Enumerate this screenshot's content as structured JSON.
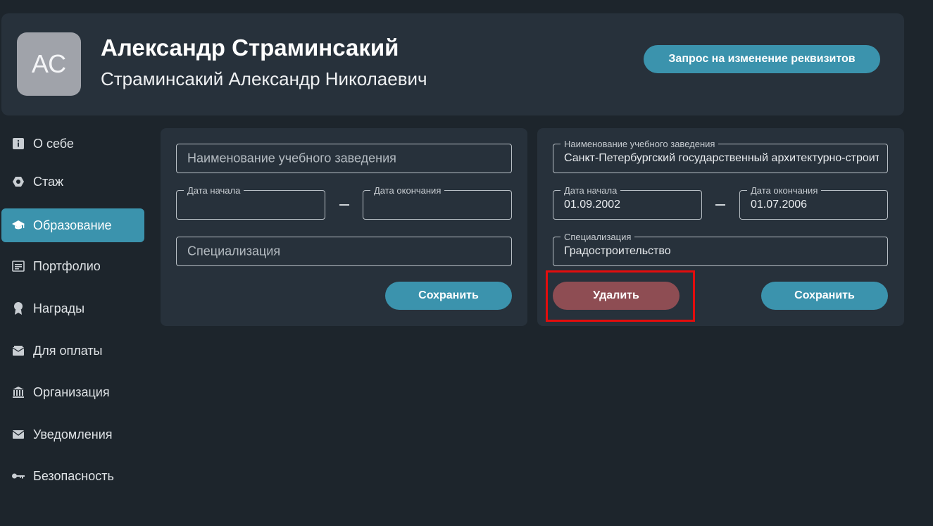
{
  "header": {
    "avatar_initials": "АС",
    "display_name": "Александр Страминсакий",
    "full_name": "Страминсакий Александр Николаевич",
    "request_button_label": "Запрос на изменение реквизитов"
  },
  "sidebar": {
    "items": [
      {
        "label": "О себе",
        "icon": "info-icon",
        "active": false
      },
      {
        "label": "Стаж",
        "icon": "hexagon-icon",
        "active": false
      },
      {
        "label": "Образование",
        "icon": "graduation-cap-icon",
        "active": true
      },
      {
        "label": "Портфолио",
        "icon": "document-list-icon",
        "active": false
      },
      {
        "label": "Награды",
        "icon": "award-icon",
        "active": false
      },
      {
        "label": "Для оплаты",
        "icon": "wallet-icon",
        "active": false
      },
      {
        "label": "Организация",
        "icon": "bank-icon",
        "active": false
      },
      {
        "label": "Уведомления",
        "icon": "envelope-icon",
        "active": false
      },
      {
        "label": "Безопасность",
        "icon": "key-icon",
        "active": false
      }
    ]
  },
  "new_form": {
    "institution_placeholder": "Наименование учебного заведения",
    "start_date_label": "Дата начала",
    "end_date_label": "Дата окончания",
    "specialization_placeholder": "Специализация",
    "save_label": "Сохранить"
  },
  "saved_form": {
    "institution_label": "Наименование учебного заведения",
    "institution_value": "Санкт-Петербургский государственный архитектурно-строительный университет",
    "start_date_label": "Дата начала",
    "start_date_value": "01.09.2002",
    "end_date_label": "Дата окончания",
    "end_date_value": "01.07.2006",
    "specialization_label": "Специализация",
    "specialization_value": "Градостроительство",
    "delete_label": "Удалить",
    "save_label": "Сохранить"
  },
  "colors": {
    "accent": "#3b93ad",
    "delete": "#8e4d53",
    "highlight": "#e30d0d",
    "background": "#1d252c",
    "card": "#27313b"
  }
}
